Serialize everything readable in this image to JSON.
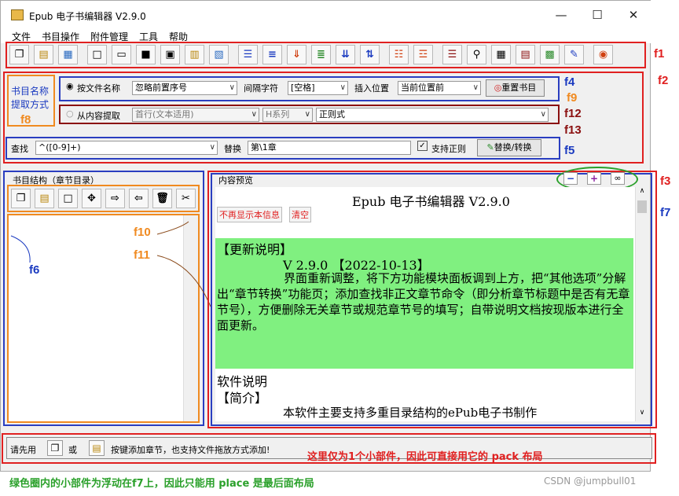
{
  "window": {
    "title": "Epub 电子书编辑器 V2.9.0",
    "minimize": "—",
    "maximize": "☐",
    "close": "✕"
  },
  "menu": [
    "文件",
    "书目操作",
    "附件管理",
    "工具",
    "帮助"
  ],
  "annotations": {
    "f1": "f1",
    "f2": "f2",
    "f3": "f3",
    "f4": "f4",
    "f5": "f5",
    "f6": "f6",
    "f7": "f7",
    "f8": "f8",
    "f9": "f9",
    "f10": "f10",
    "f11": "f11",
    "f12": "f12",
    "f13": "f13"
  },
  "extract": {
    "label": "书目名称提取方式",
    "by_file": "按文件名称",
    "file_option": "忽略前置序号",
    "sep_label": "间隔字符",
    "sep_value": "[空格]",
    "insert_label": "插入位置",
    "insert_value": "当前位置前",
    "reset": "重置书目",
    "by_content": "从内容提取",
    "content_option": "首行(文本适用)",
    "series": "H系列",
    "regex": "正则式"
  },
  "find": {
    "label": "查找",
    "pattern": "^([0-9]+)",
    "replace_label": "替换",
    "replace_value": "第\\1章",
    "regex_label": "支持正则",
    "action": "替换/转换"
  },
  "tree": {
    "title": "书目结构（章节目录）"
  },
  "preview": {
    "title": "内容预览",
    "heading": "Epub 电子书编辑器  V2.9.0",
    "no_show": "不再显示本信息",
    "clear": "清空",
    "update_header": "【更新说明】",
    "version_line": "V 2.9.0 【2022-10-13】",
    "update_body": "界面重新调整，将下方功能模块面板调到上方，把“其他选项”分解出“章节转换”功能页；添加查找非正文章节命令（即分析章节标题中是否有无章节号），方便删除无关章节或规范章节号的填写；自带说明文档按现版本进行全面更新。",
    "soft_title": "软件说明",
    "intro_title": "【简介】",
    "intro_body": "本软件主要支持多重目录结构的ePub电子书制作"
  },
  "status": {
    "p1": "请先用",
    "p2": "或",
    "p3": "按键添加章节，也支持文件拖放方式添加!"
  },
  "notes": {
    "status_note": "这里仅为1个小部件，因此可直接用它的 pack 布局",
    "bottom_note": "绿色圈内的小部件为浮动在f7上，因此只能用 place 是最后面布局",
    "watermark": "CSDN @jumpbull01"
  },
  "colors": {
    "red": "#e02020",
    "blue": "#2a3ec0",
    "orange": "#f08a20",
    "green": "#2aa02a",
    "dark_red": "#8b1010",
    "preview_green": "#80f080"
  }
}
